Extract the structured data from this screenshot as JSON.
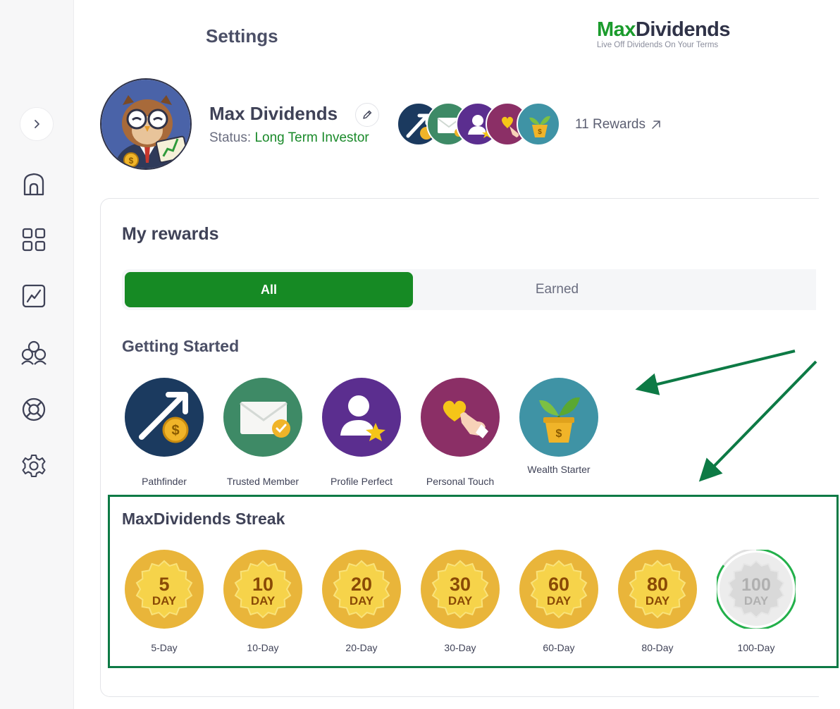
{
  "header": {
    "title": "Settings",
    "logo_max": "Max",
    "logo_dividends": "Dividends",
    "logo_tagline": "Live Off Dividends On Your Terms"
  },
  "sidebar": {
    "items": [
      {
        "name": "home",
        "icon": "home-icon"
      },
      {
        "name": "dashboard",
        "icon": "grid-icon"
      },
      {
        "name": "analytics",
        "icon": "chart-icon"
      },
      {
        "name": "community",
        "icon": "people-icon"
      },
      {
        "name": "support",
        "icon": "lifebuoy-icon"
      },
      {
        "name": "settings",
        "icon": "gear-icon"
      }
    ]
  },
  "profile": {
    "name": "Max Dividends",
    "status_label": "Status:",
    "status_value": "Long Term Investor",
    "rewards_link": "11 Rewards"
  },
  "rewards": {
    "title": "My rewards",
    "tabs": [
      {
        "label": "All",
        "selected": true
      },
      {
        "label": "Earned",
        "selected": false
      }
    ],
    "getting_started": {
      "title": "Getting Started",
      "badges": [
        {
          "label": "Pathfinder",
          "color": "#1b3a5f"
        },
        {
          "label": "Trusted Member",
          "color": "#3e8a66"
        },
        {
          "label": "Profile Perfect",
          "color": "#5b2e8f"
        },
        {
          "label": "Personal Touch",
          "color": "#8b2f66"
        },
        {
          "label": "Wealth Starter",
          "color": "#3f93a5"
        }
      ]
    },
    "streak": {
      "title": "MaxDividends Streak",
      "badges": [
        {
          "num": "5",
          "unit": "DAY",
          "label": "5-Day",
          "earned": true
        },
        {
          "num": "10",
          "unit": "DAY",
          "label": "10-Day",
          "earned": true
        },
        {
          "num": "20",
          "unit": "DAY",
          "label": "20-Day",
          "earned": true
        },
        {
          "num": "30",
          "unit": "DAY",
          "label": "30-Day",
          "earned": true
        },
        {
          "num": "60",
          "unit": "DAY",
          "label": "60-Day",
          "earned": true
        },
        {
          "num": "80",
          "unit": "DAY",
          "label": "80-Day",
          "earned": true
        },
        {
          "num": "100",
          "unit": "DAY",
          "label": "100-Day",
          "earned": false,
          "progress": 0.85
        }
      ]
    }
  },
  "colors": {
    "brand_green": "#168a24",
    "annotation_green": "#0d7a45",
    "gold": "#f0c142"
  }
}
